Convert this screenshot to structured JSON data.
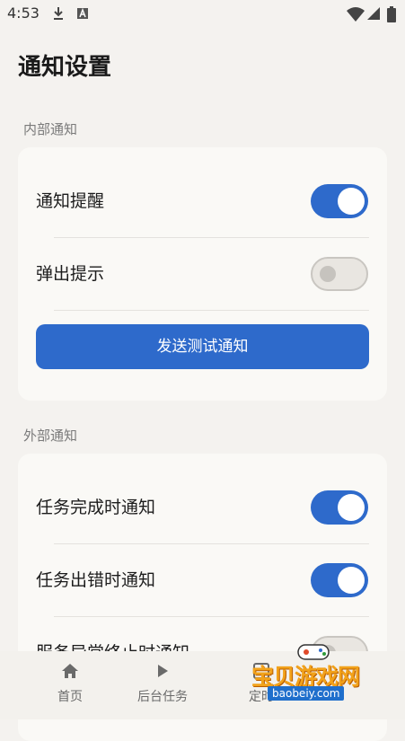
{
  "status_bar": {
    "time": "4:53"
  },
  "page": {
    "title": "通知设置"
  },
  "sections": [
    {
      "label": "内部通知",
      "rows": [
        {
          "label": "通知提醒",
          "enabled": true
        },
        {
          "label": "弹出提示",
          "enabled": false
        }
      ],
      "button_label": "发送测试通知"
    },
    {
      "label": "外部通知",
      "rows": [
        {
          "label": "任务完成时通知",
          "enabled": true
        },
        {
          "label": "任务出错时通知",
          "enabled": true
        },
        {
          "label": "服务异常终止时通知",
          "enabled": false
        }
      ]
    }
  ],
  "nav": {
    "items": [
      {
        "label": "首页",
        "icon": "home-icon"
      },
      {
        "label": "后台任务",
        "icon": "play-icon"
      },
      {
        "label": "定时",
        "icon": "timer-icon"
      }
    ]
  },
  "watermark": {
    "text": "宝贝游戏网",
    "url": "baobeiy.com"
  },
  "colors": {
    "accent": "#2e6acb",
    "background": "#f4f2ef",
    "card": "#faf9f6"
  }
}
